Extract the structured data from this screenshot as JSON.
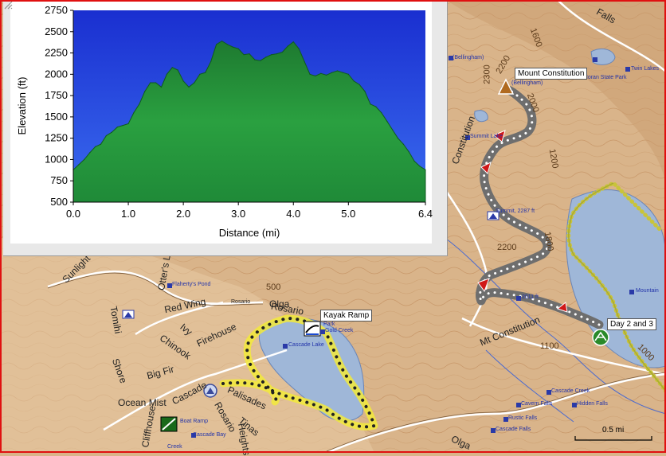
{
  "colors": {
    "terrain": "#d9b48a",
    "lake": "#9fb7d8",
    "contour": "#b6794a",
    "track_gray": "#6e6e6e",
    "track_yellow": "#f2ea3a",
    "frame_red": "#e01010",
    "chart_sky": "#1f3fd8",
    "chart_fill": "#1f8a3a"
  },
  "map": {
    "callouts": {
      "mount_constitution": "Mount Constitution",
      "day2and3": "Day 2 and 3",
      "kayak_ramp": "Kayak Ramp"
    },
    "scale_label": "0.5 mi",
    "roads": [
      "Sunlight",
      "Otter's Lair",
      "Red Wing",
      "Rosario",
      "Olga",
      "Firehouse",
      "Chinook",
      "Ivy",
      "Tomihi",
      "Shore",
      "Big Fir",
      "Cascade",
      "Ocean Mist",
      "Cliffhouse",
      "Rosario",
      "Palisades",
      "Tinas",
      "Heights",
      "Mt Constitution",
      "Olga",
      "Falls",
      "Constitution"
    ],
    "contours": [
      "500",
      "1600",
      "2300",
      "2200",
      "2000",
      "1200",
      "1800",
      "2200",
      "1100",
      "1000"
    ],
    "pois": [
      "(Bellingham)",
      "(Bellingham)",
      "Moran State Park",
      "Twin Lakes",
      "Summit Lake",
      "Summit, 2287 ft",
      "2011 ft",
      "Mountain",
      "Flaherty's Pond",
      "Rosario",
      "Cascade Lake",
      "Gold Creek",
      "Park",
      "Boat Ramp",
      "Cascade Bay",
      "Cascade Creek",
      "Cavern Falls",
      "Hidden Falls",
      "Rustic Falls",
      "Cascade Falls",
      "Creek"
    ],
    "icons": [
      "summit-triangle-icon",
      "red-arrow-icon",
      "picnic-table-icon",
      "camp-icon",
      "boat-ramp-icon",
      "kayak-ramp-icon"
    ]
  },
  "chart_data": {
    "type": "area",
    "xlabel": "Distance",
    "xunit": "(mi)",
    "ylabel": "Elevation",
    "yunit": "(ft)",
    "xlim": [
      0,
      6.4
    ],
    "ylim": [
      500,
      2750
    ],
    "x_ticks": [
      "0.0",
      "1.0",
      "2.0",
      "3.0",
      "4.0",
      "5.0",
      "6.4"
    ],
    "y_ticks": [
      "2750",
      "2500",
      "2250",
      "2000",
      "1750",
      "1500",
      "1250",
      "1000",
      "750",
      "500"
    ],
    "grid": false,
    "x": [
      0.0,
      0.1,
      0.2,
      0.3,
      0.4,
      0.5,
      0.6,
      0.7,
      0.8,
      0.9,
      1.0,
      1.1,
      1.2,
      1.3,
      1.4,
      1.5,
      1.6,
      1.7,
      1.8,
      1.9,
      2.0,
      2.1,
      2.2,
      2.3,
      2.4,
      2.5,
      2.6,
      2.7,
      2.8,
      2.9,
      3.0,
      3.1,
      3.2,
      3.3,
      3.4,
      3.5,
      3.6,
      3.7,
      3.8,
      3.9,
      4.0,
      4.1,
      4.2,
      4.3,
      4.4,
      4.5,
      4.6,
      4.7,
      4.8,
      4.9,
      5.0,
      5.1,
      5.2,
      5.3,
      5.4,
      5.5,
      5.6,
      5.7,
      5.8,
      5.9,
      6.0,
      6.1,
      6.2,
      6.3,
      6.4
    ],
    "values": [
      880,
      940,
      1000,
      1080,
      1150,
      1180,
      1280,
      1320,
      1380,
      1400,
      1420,
      1550,
      1650,
      1800,
      1900,
      1900,
      1850,
      2000,
      2080,
      2050,
      1920,
      1850,
      1900,
      2000,
      2020,
      2150,
      2350,
      2390,
      2350,
      2320,
      2300,
      2230,
      2240,
      2170,
      2160,
      2200,
      2230,
      2240,
      2260,
      2330,
      2380,
      2300,
      2150,
      2000,
      1980,
      2010,
      1990,
      2020,
      2040,
      2020,
      2000,
      1920,
      1880,
      1800,
      1650,
      1620,
      1550,
      1450,
      1350,
      1250,
      1180,
      1090,
      980,
      920,
      880
    ]
  }
}
